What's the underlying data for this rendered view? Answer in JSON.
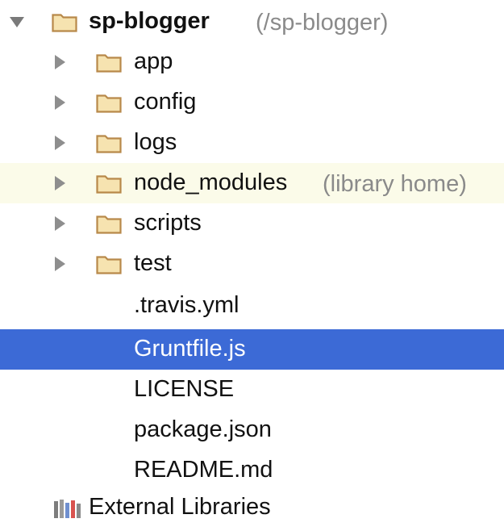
{
  "project": {
    "name": "sp-blogger",
    "path_hint": "(/sp-blogger)"
  },
  "folders": [
    {
      "label": "app"
    },
    {
      "label": "config"
    },
    {
      "label": "logs"
    },
    {
      "label": "node_modules",
      "hint": "(library home)"
    },
    {
      "label": "scripts"
    },
    {
      "label": "test"
    }
  ],
  "files": [
    {
      "label": ".travis.yml"
    },
    {
      "label": "Gruntfile.js"
    },
    {
      "label": "LICENSE"
    },
    {
      "label": "package.json"
    },
    {
      "label": "README.md"
    }
  ],
  "external_libraries": {
    "label": "External Libraries"
  },
  "colors": {
    "selection": "#3c6ad6",
    "highlight_row": "#fbfbe9",
    "folder_fill": "#f6e3b0",
    "folder_stroke": "#b8894a"
  }
}
